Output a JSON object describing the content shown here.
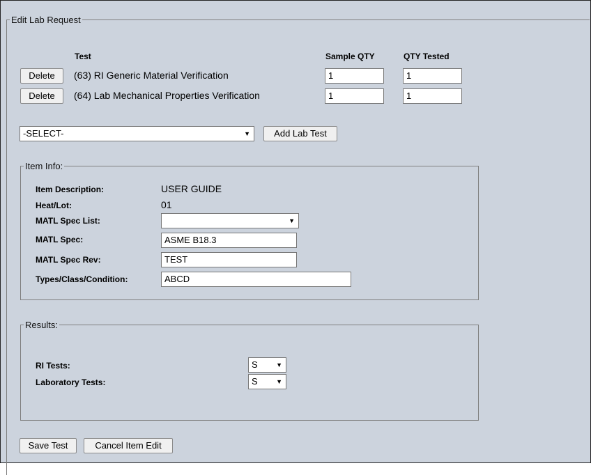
{
  "form": {
    "legend": "Edit Lab Request",
    "headers": {
      "test": "Test",
      "sample_qty": "Sample QTY",
      "qty_tested": "QTY Tested"
    },
    "rows": [
      {
        "delete_label": "Delete",
        "test": "(63) RI Generic Material Verification",
        "sample_qty": "1",
        "qty_tested": "1"
      },
      {
        "delete_label": "Delete",
        "test": "(64) Lab Mechanical Properties Verification",
        "sample_qty": "1",
        "qty_tested": "1"
      }
    ],
    "test_select": {
      "value": "-SELECT-"
    },
    "add_lab_test_label": "Add Lab Test",
    "dropdown_arrow": "▼"
  },
  "item_info": {
    "legend": "Item Info:",
    "labels": {
      "description": "Item Description:",
      "heat_lot": "Heat/Lot:",
      "spec_list": "MATL Spec List:",
      "spec": "MATL Spec:",
      "spec_rev": "MATL Spec Rev:",
      "types": "Types/Class/Condition:"
    },
    "values": {
      "description": "USER GUIDE",
      "heat_lot": "01",
      "spec_list": "",
      "spec": "ASME B18.3",
      "spec_rev": "TEST",
      "types": "ABCD"
    }
  },
  "results": {
    "legend": "Results:",
    "ri_tests_label": "RI Tests:",
    "ri_tests_value": "S",
    "lab_tests_label": "Laboratory Tests:",
    "lab_tests_value": "S"
  },
  "actions": {
    "save_label": "Save Test",
    "cancel_label": "Cancel Item Edit"
  }
}
